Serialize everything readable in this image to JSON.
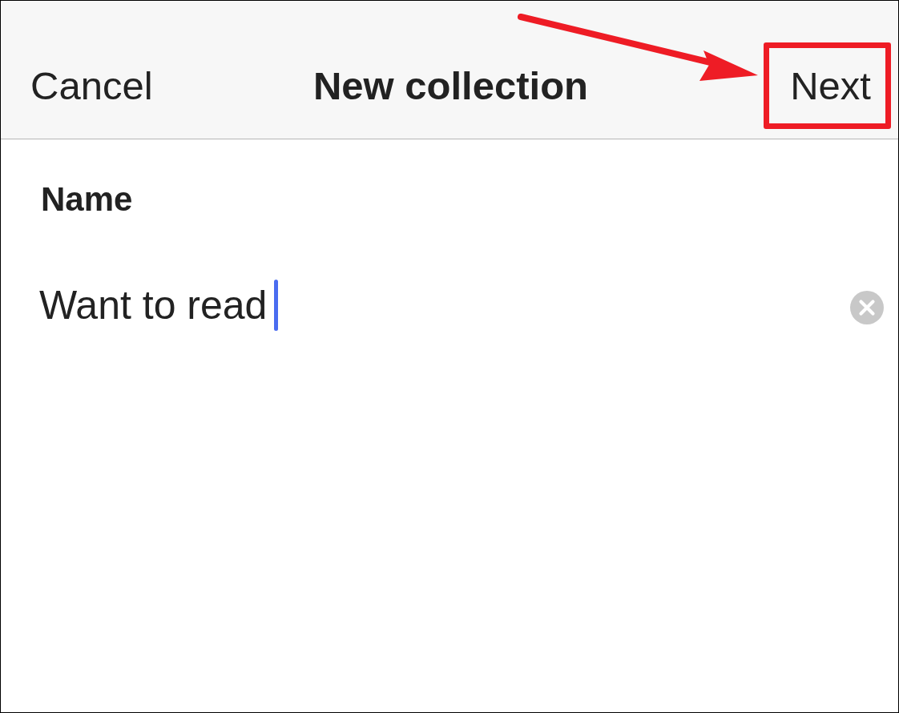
{
  "nav_bar": {
    "cancel": "Cancel",
    "title": "New collection",
    "next": {
      "label": "Next",
      "highlighted": true
    }
  },
  "form": {
    "label": "Name",
    "value": "Want to read",
    "focused": true
  }
}
